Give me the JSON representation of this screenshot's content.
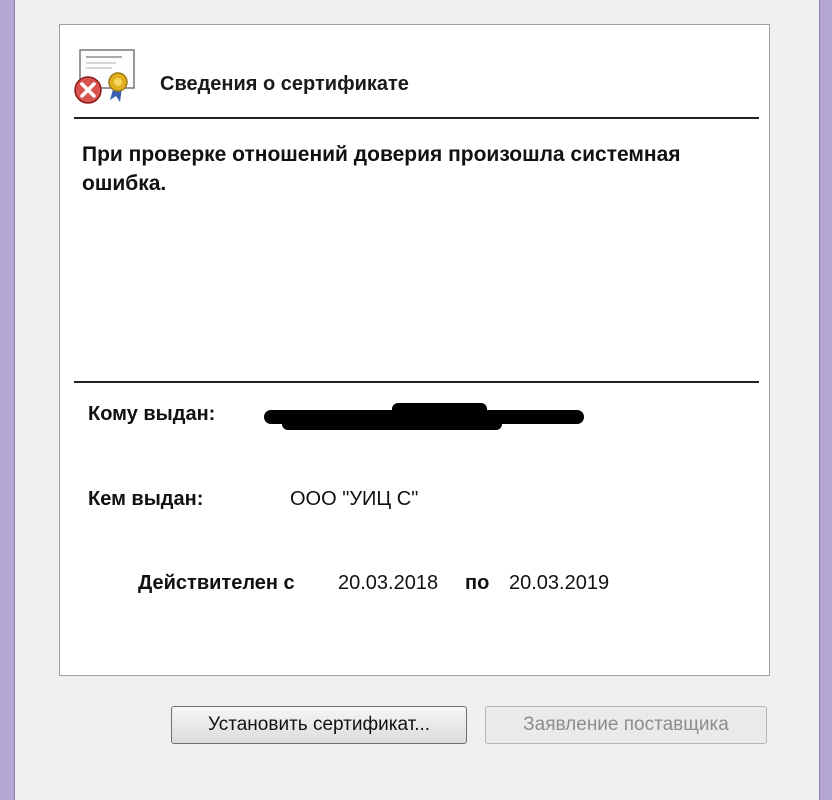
{
  "dialog": {
    "header_title": "Сведения о сертификате",
    "icon": "certificate-error-icon",
    "error_message": "При проверке отношений доверия произошла системная ошибка."
  },
  "details": {
    "issued_to_label": "Кому выдан:",
    "issued_by_label": "Кем выдан:",
    "issued_by_value": "ООО \"УИЦ С\"",
    "valid_from_label": "Действителен с",
    "valid_from": "20.03.2018",
    "valid_to_label": "по",
    "valid_to": "20.03.2019"
  },
  "buttons": {
    "install": "Установить сертификат...",
    "issuer_statement": "Заявление поставщика"
  },
  "colors": {
    "error_red": "#d9534f",
    "seal_gold": "#e0b020",
    "window_border": "#b4a8d2"
  }
}
